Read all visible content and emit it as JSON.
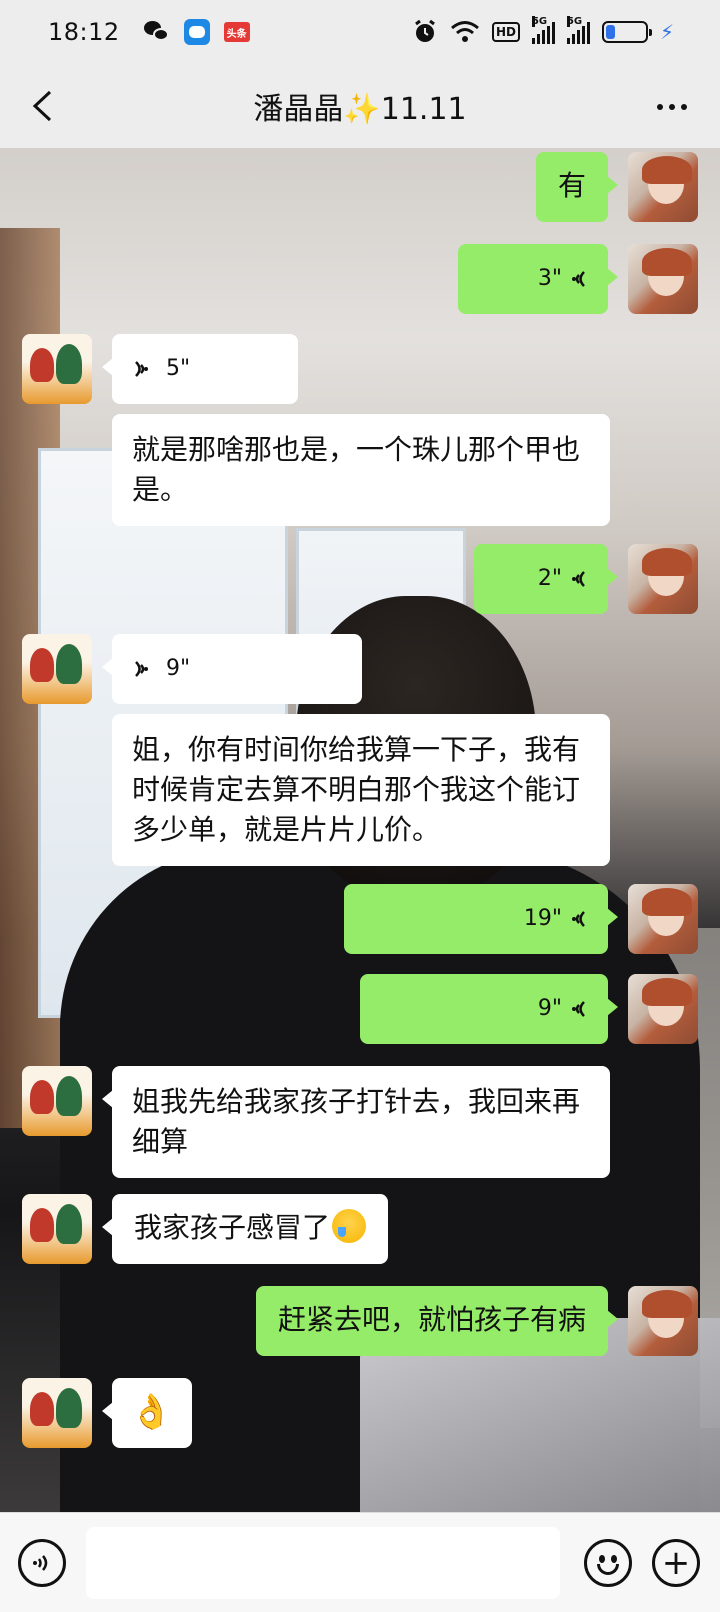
{
  "status_bar": {
    "time": "18:12",
    "news_badge": "头条",
    "hd_label": "HD",
    "sig1_label": "5G",
    "sig2_label": "5G",
    "battery_level": 0.25
  },
  "header": {
    "title": "潘晶晶✨11.11"
  },
  "messages": [
    {
      "side": "out",
      "type": "text",
      "text": "有"
    },
    {
      "side": "out",
      "type": "voice",
      "duration": "3\""
    },
    {
      "side": "in",
      "type": "voice",
      "duration": "5\""
    },
    {
      "side": "in",
      "type": "text",
      "text": "就是那啥那也是，一个珠儿那个甲也是。"
    },
    {
      "side": "out",
      "type": "voice",
      "duration": "2\""
    },
    {
      "side": "in",
      "type": "voice",
      "duration": "9\""
    },
    {
      "side": "in",
      "type": "text",
      "text": "姐，你有时间你给我算一下子，我有时候肯定去算不明白那个我这个能订多少单，就是片片儿价。"
    },
    {
      "side": "out",
      "type": "voice",
      "duration": "19\""
    },
    {
      "side": "out",
      "type": "voice",
      "duration": "9\""
    },
    {
      "side": "in",
      "type": "text",
      "text": "姐我先给我家孩子打针去，我回来再细算"
    },
    {
      "side": "in",
      "type": "text",
      "text": "我家孩子感冒了",
      "emoji": "crying-laugh-emoji"
    },
    {
      "side": "out",
      "type": "text",
      "text": "赶紧去吧，就怕孩子有病"
    },
    {
      "side": "in",
      "type": "emoji",
      "text": "👌"
    }
  ],
  "input": {
    "placeholder": "",
    "value": ""
  },
  "colors": {
    "outgoing_bubble": "#95ec69",
    "incoming_bubble": "#ffffff",
    "bar_background": "#ededed",
    "accent_blue": "#2f6fe8"
  },
  "icons": [
    "back-arrow-icon",
    "more-icon",
    "voice-toggle-icon",
    "emoji-icon",
    "plus-icon",
    "wechat-icon",
    "assistant-app-icon",
    "alarm-icon",
    "wifi-icon",
    "battery-icon"
  ]
}
